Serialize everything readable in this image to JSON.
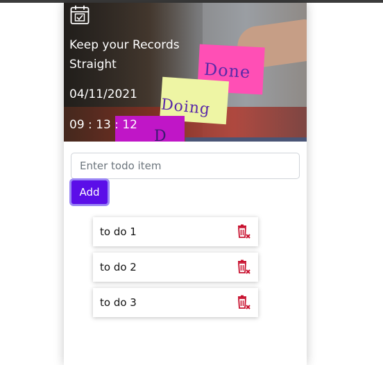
{
  "header": {
    "title": "Keep your Records Straight",
    "date": "04/11/2021",
    "time": "09 : 13 : 12",
    "icon": "calendar-check-icon",
    "image_notes": [
      "Done",
      "Doing",
      "D"
    ]
  },
  "form": {
    "input_placeholder": "Enter todo item",
    "input_value": "",
    "add_label": "Add"
  },
  "todos": [
    {
      "label": "to do 1",
      "icon": "delete-icon"
    },
    {
      "label": "to do 2",
      "icon": "delete-icon"
    },
    {
      "label": "to do 3",
      "icon": "delete-icon"
    }
  ],
  "colors": {
    "accent": "#5b0ee8",
    "delete": "#c8102e"
  }
}
